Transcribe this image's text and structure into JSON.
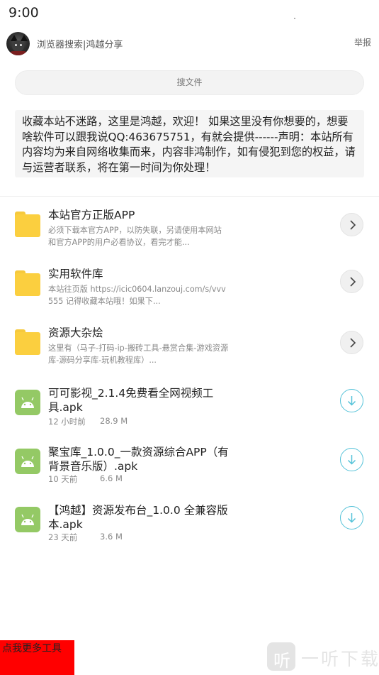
{
  "statusbar": {
    "time": "9:00"
  },
  "header": {
    "site_title": "浏览器搜索|鸿越分享",
    "report_label": "举报"
  },
  "search": {
    "placeholder": "搜文件"
  },
  "notice": {
    "text": "收藏本站不迷路，这里是鸿越，欢迎！ 如果这里没有你想要的，想要啥软件可以跟我说QQ:463675751，有就会提供------声明：本站所有内容均为来自网络收集而来，内容非鸿制作，如有侵犯到您的权益，请与运营者联系，将在第一时间为你处理！"
  },
  "folders": [
    {
      "title": "本站官方正版APP",
      "desc": "必须下载本官方APP，以防失联，另请使用本网站和官方APP的用户必看协议，看完才能..."
    },
    {
      "title": "实用软件库",
      "desc": "本站往页版 https://icic0604.lanzouj.com/s/vvv555 记得收藏本站哦！如果下..."
    },
    {
      "title": "资源大杂烩",
      "desc": "这里有（马子-打码-ip-搬砖工具-悬赏合集-游戏资源库-源码分享库-玩机教程库）..."
    }
  ],
  "files": [
    {
      "title": "可可影视_2.1.4免费看全网视频工具.apk",
      "time": "12 小时前",
      "size": "28.9 M"
    },
    {
      "title": "聚宝库_1.0.0_一款资源综合APP（有背景音乐版）.apk",
      "time": "10 天前",
      "size": "6.6 M"
    },
    {
      "title": "【鸿越】资源发布台_1.0.0 全兼容版本.apk",
      "time": "23 天前",
      "size": "3.6 M"
    }
  ],
  "more_button": {
    "label": "点我更多工具"
  },
  "watermark": {
    "logo_char": "听",
    "text": "一听下载"
  },
  "icons": [
    "avatar",
    "folder-icon",
    "android-icon",
    "chevron-right-icon",
    "download-icon"
  ],
  "colors": {
    "folder": "#fbcf3f",
    "android": "#94c965",
    "download_accent": "#54c2d8",
    "more_button_bg": "#ff0000"
  }
}
